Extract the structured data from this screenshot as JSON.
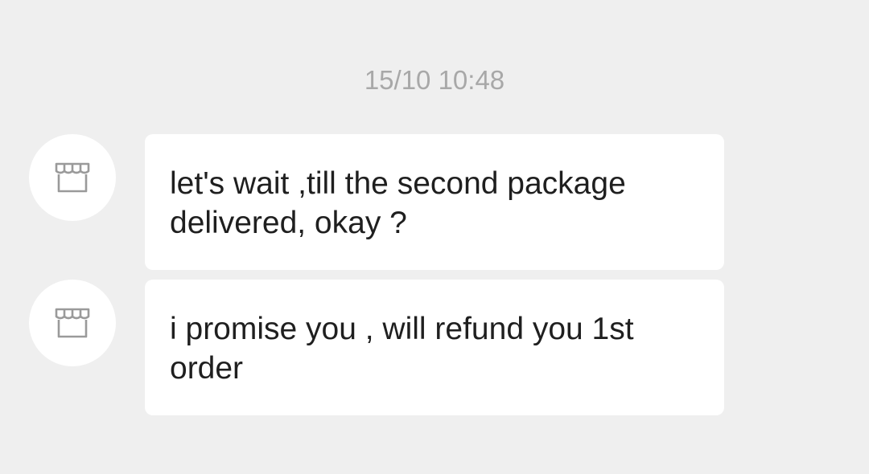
{
  "conversation": {
    "timestamp": "15/10 10:48",
    "messages": [
      {
        "sender_avatar_icon": "store-icon",
        "text": "let's wait ,till the second package delivered, okay ?"
      },
      {
        "sender_avatar_icon": "store-icon",
        "text": "i promise you , will refund you 1st order"
      }
    ]
  },
  "colors": {
    "background": "#efefef",
    "bubble": "#ffffff",
    "text": "#1f1f1f",
    "timestamp": "#a8a8a8",
    "icon_stroke": "#9a9a9a"
  }
}
